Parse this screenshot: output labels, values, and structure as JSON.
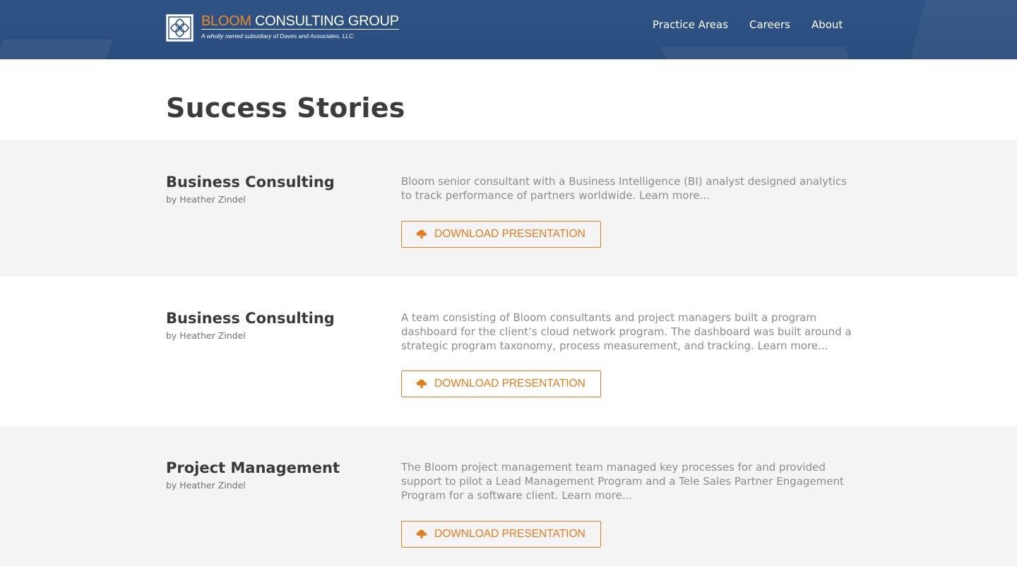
{
  "header": {
    "logo": {
      "bloom": "BLOOM",
      "rest": " CONSULTING GROUP",
      "subtitle": "A wholly owned subsidiary of Daves and Associates, LLC."
    },
    "nav": [
      {
        "label": "Practice Areas"
      },
      {
        "label": "Careers"
      },
      {
        "label": "About"
      }
    ]
  },
  "page": {
    "title": "Success Stories"
  },
  "stories": [
    {
      "title": "Business Consulting",
      "author": "by Heather Zindel",
      "description": "Bloom senior consultant with a Business Intelligence (BI) analyst designed analytics to track performance of partners worldwide. Learn more...",
      "button_label": "DOWNLOAD PRESENTATION",
      "button_icon": "cloud-download-icon"
    },
    {
      "title": "Business Consulting",
      "author": "by Heather Zindel",
      "description": "A team consisting of Bloom consultants and project managers built a program dashboard for the client’s cloud network program. The dashboard was built around a strategic program taxonomy, process measurement, and tracking. Learn more...",
      "button_label": "DOWNLOAD PRESENTATION",
      "button_icon": "cloud-download-icon"
    },
    {
      "title": "Project Management",
      "author": "by Heather Zindel",
      "description": "The Bloom project management team managed key processes for and provided support to pilot a Lead Management Program and a Tele Sales Partner Engagement Program for a software client. Learn more...",
      "button_label": "DOWNLOAD PRESENTATION",
      "button_icon": "cloud-download-icon"
    }
  ],
  "colors": {
    "header_bg": "#2e5385",
    "accent": "#e57d1e",
    "band_gray": "#f4f4f4",
    "title_text": "#3c3c3c",
    "body_text": "#8c8c8c"
  }
}
